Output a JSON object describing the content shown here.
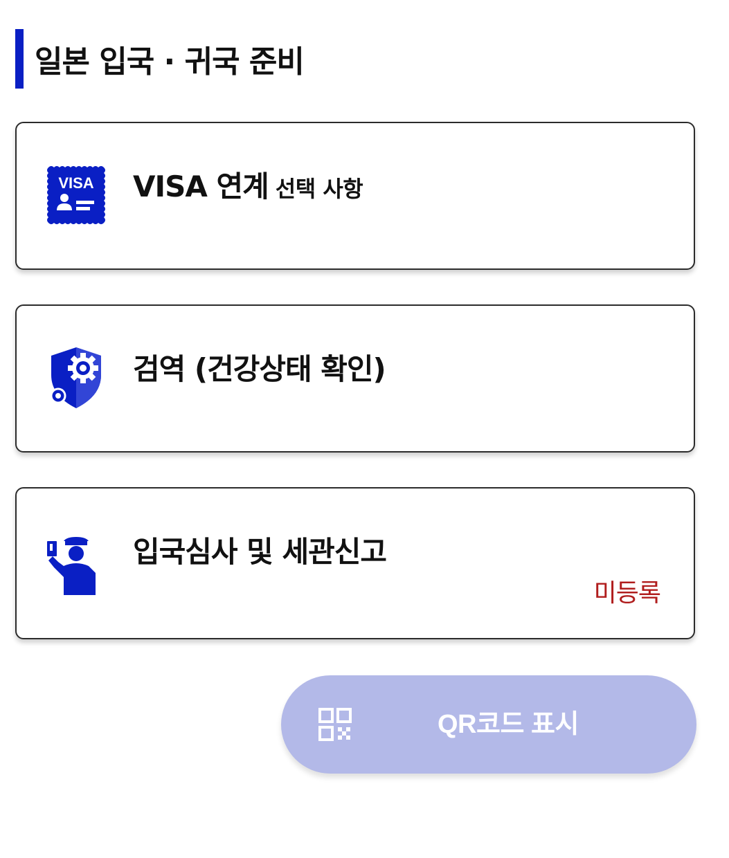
{
  "section": {
    "title": "일본 입국 · 귀국 준비",
    "accent_color": "#0a1fc4"
  },
  "cards": [
    {
      "id": "visa",
      "title": "VISA 연계",
      "subtitle": "선택 사항",
      "icon": "visa-card-icon",
      "icon_text": "VISA"
    },
    {
      "id": "quarantine",
      "title": "검역 (건강상태 확인)",
      "icon": "shield-gear-icon"
    },
    {
      "id": "immigration",
      "title": "입국심사 및 세관신고",
      "icon": "immigration-officer-icon",
      "status": "미등록",
      "status_color": "#b01d1d"
    }
  ],
  "qr_button": {
    "label": "QR코드 표시",
    "icon": "qr-code-icon",
    "background": "#b3b9e8",
    "state": "disabled"
  }
}
